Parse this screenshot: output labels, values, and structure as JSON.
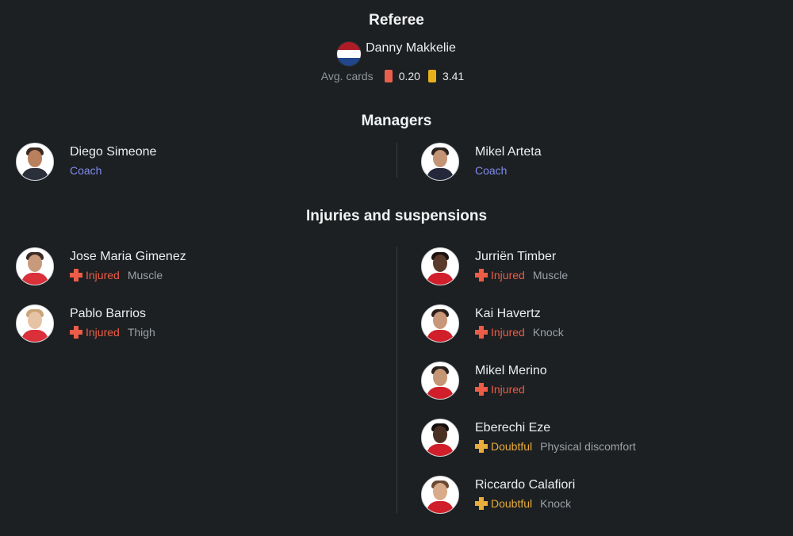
{
  "referee": {
    "title": "Referee",
    "name": "Danny Makkelie",
    "avg_cards_label": "Avg. cards",
    "red_cards": "0.20",
    "yellow_cards": "3.41",
    "colors": {
      "red_card": "#e8604d",
      "yellow_card": "#e7b11b",
      "flag": [
        "#ae1c28",
        "#ffffff",
        "#21468b"
      ]
    }
  },
  "managers": {
    "title": "Managers",
    "items": [
      {
        "name": "Diego Simeone",
        "role": "Coach"
      },
      {
        "name": "Mikel Arteta",
        "role": "Coach"
      }
    ]
  },
  "injuries": {
    "title": "Injuries and suspensions",
    "left": [
      {
        "name": "Jose Maria Gimenez",
        "status": "Injured",
        "reason": "Muscle"
      },
      {
        "name": "Pablo Barrios",
        "status": "Injured",
        "reason": "Thigh"
      }
    ],
    "right": [
      {
        "name": "Jurriën Timber",
        "status": "Injured",
        "reason": "Muscle"
      },
      {
        "name": "Kai Havertz",
        "status": "Injured",
        "reason": "Knock"
      },
      {
        "name": "Mikel Merino",
        "status": "Injured",
        "reason": ""
      },
      {
        "name": "Eberechi Eze",
        "status": "Doubtful",
        "reason": "Physical discomfort"
      },
      {
        "name": "Riccardo Calafiori",
        "status": "Doubtful",
        "reason": "Knock"
      }
    ]
  },
  "colors": {
    "injured": "#ec5c47",
    "doubtful": "#e8ad3c",
    "coach": "#7e8bf0",
    "background": "#1d2022"
  }
}
